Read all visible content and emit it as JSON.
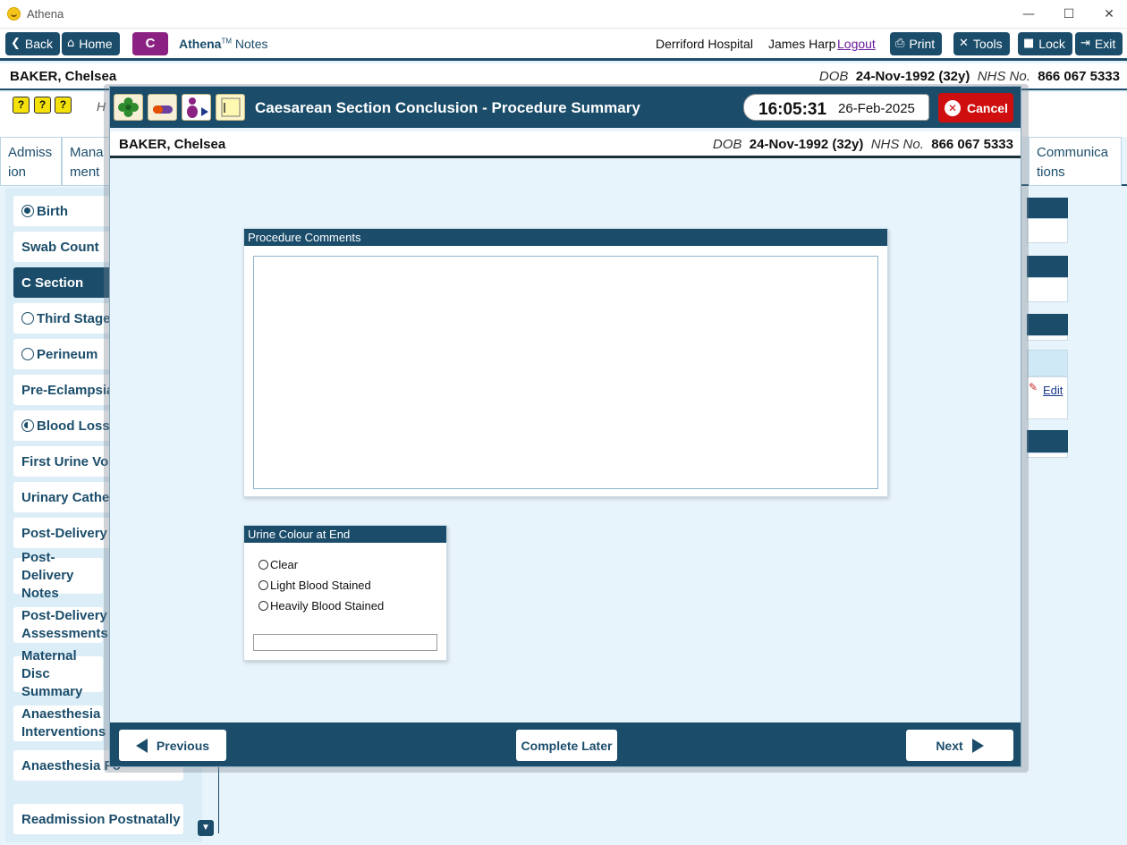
{
  "window": {
    "title": "Athena",
    "minimize_label": "—",
    "maximize_label": "☐",
    "close_label": "✕"
  },
  "nav": {
    "back_label": "Back",
    "home_label": "Home",
    "c_label": "C",
    "brand_name": "Athena",
    "brand_tm": "TM",
    "brand_suffix": "Notes",
    "hospital": "Derriford Hospital",
    "user": "James Harp",
    "logout_label": "Logout",
    "print_label": "Print",
    "tools_label": "Tools",
    "lock_label": "Lock",
    "exit_label": "Exit"
  },
  "patient": {
    "name": "BAKER, Chelsea",
    "dob_label": "DOB",
    "dob": "24-Nov-1992 (32y)",
    "nhs_label": "NHS No.",
    "nhs": "866 067 5333"
  },
  "help": {
    "partial_text": "H"
  },
  "tabs": {
    "admission": "Admiss ion",
    "management": "Mana ment",
    "communications": "Communica tions"
  },
  "sidebar": {
    "items": [
      {
        "label": "Birth",
        "status": "filled"
      },
      {
        "label": "Swab Count"
      },
      {
        "label": "C Section",
        "active": true
      },
      {
        "label": "Third Stage",
        "status": "empty"
      },
      {
        "label": "Perineum",
        "status": "empty"
      },
      {
        "label": "Pre-Eclampsia"
      },
      {
        "label": "Blood Loss",
        "status": "half"
      },
      {
        "label": "First Urine Voi"
      },
      {
        "label": "Urinary Cathe"
      },
      {
        "label": "Post-Delivery"
      },
      {
        "label": "Post-Delivery Notes"
      },
      {
        "label": "Post-Delivery Assessments"
      },
      {
        "label": "Maternal Disc Summary"
      },
      {
        "label": "Anaesthesia Interventions"
      },
      {
        "label": "Anaesthesia Fo"
      },
      {
        "label": "Readmission Postnatally"
      }
    ]
  },
  "background_panel": {
    "edit_label": "Edit"
  },
  "modal": {
    "title": "Caesarean Section Conclusion - Procedure Summary",
    "time": "16:05:31",
    "date": "26-Feb-2025",
    "cancel_label": "Cancel",
    "procedure_comments": {
      "heading": "Procedure Comments",
      "value": ""
    },
    "urine_colour": {
      "heading": "Urine Colour at End",
      "options": [
        "Clear",
        "Light Blood Stained",
        "Heavily Blood Stained"
      ],
      "selected": null,
      "other_value": ""
    },
    "footer": {
      "previous_label": "Previous",
      "complete_later_label": "Complete Later",
      "next_label": "Next"
    }
  },
  "colors": {
    "primary": "#1b4d6b",
    "background": "#e8f4fb",
    "c_button": "#8b2182",
    "cancel": "#cf0f0f",
    "logout_link": "#6a1b9a"
  }
}
